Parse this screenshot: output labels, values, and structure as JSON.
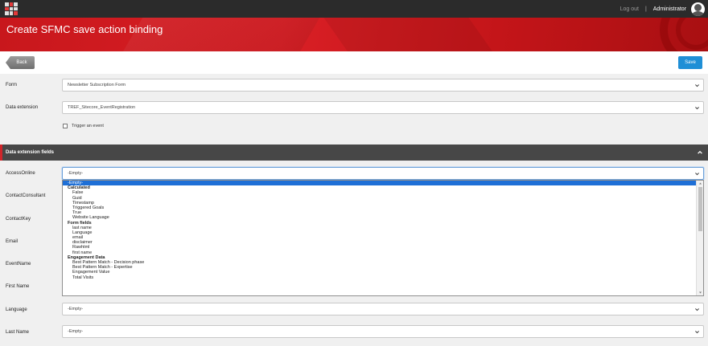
{
  "topbar": {
    "logout": "Log out",
    "separator": "|",
    "user": "Administrator"
  },
  "header": {
    "title": "Create SFMC save action binding"
  },
  "actions": {
    "back": "Back",
    "save": "Save"
  },
  "form": {
    "form_label": "Form",
    "form_value": "Newsletter Subscription Form",
    "data_extension_label": "Data extension",
    "data_extension_value": "TREF_Sitecore_EventRegistration",
    "trigger_label": "Trigger an event"
  },
  "section": {
    "title": "Data extension fields"
  },
  "fields": [
    {
      "label": "AccessOnline",
      "value": "-Empty-"
    },
    {
      "label": "ContactConsultant",
      "value": ""
    },
    {
      "label": "ContactKey",
      "value": ""
    },
    {
      "label": "Email",
      "value": ""
    },
    {
      "label": "EventName",
      "value": ""
    },
    {
      "label": "First Name",
      "value": ""
    },
    {
      "label": "Language",
      "value": "-Empty-"
    },
    {
      "label": "Last Name",
      "value": "-Empty-"
    }
  ],
  "dropdown": {
    "items": [
      {
        "text": "-Empty-",
        "kind": "selected"
      },
      {
        "text": "Calculated",
        "kind": "group"
      },
      {
        "text": "False",
        "kind": "opt"
      },
      {
        "text": "Guid",
        "kind": "opt"
      },
      {
        "text": "Timestamp",
        "kind": "opt"
      },
      {
        "text": "Triggered Goals",
        "kind": "opt"
      },
      {
        "text": "True",
        "kind": "opt"
      },
      {
        "text": "Website Language",
        "kind": "opt"
      },
      {
        "text": "Form fields",
        "kind": "group"
      },
      {
        "text": "last name",
        "kind": "opt"
      },
      {
        "text": "Language",
        "kind": "opt"
      },
      {
        "text": "email",
        "kind": "opt"
      },
      {
        "text": "disclaimer",
        "kind": "opt"
      },
      {
        "text": "Rawhtml",
        "kind": "opt"
      },
      {
        "text": "first name",
        "kind": "opt"
      },
      {
        "text": "Engagement Data",
        "kind": "group"
      },
      {
        "text": "Best Pattern Match - Decision phase",
        "kind": "opt"
      },
      {
        "text": "Best Pattern Match - Expertise",
        "kind": "opt"
      },
      {
        "text": "Engagement Value",
        "kind": "opt"
      },
      {
        "text": "Total Visits",
        "kind": "opt"
      }
    ]
  },
  "colors": {
    "brand_red": "#d91f25",
    "save_blue": "#1f8fd6",
    "selected_blue": "#1e6fd6"
  },
  "icons": [
    "app-grid-icon",
    "avatar-icon",
    "chevron-down-icon",
    "chevron-up-icon"
  ]
}
